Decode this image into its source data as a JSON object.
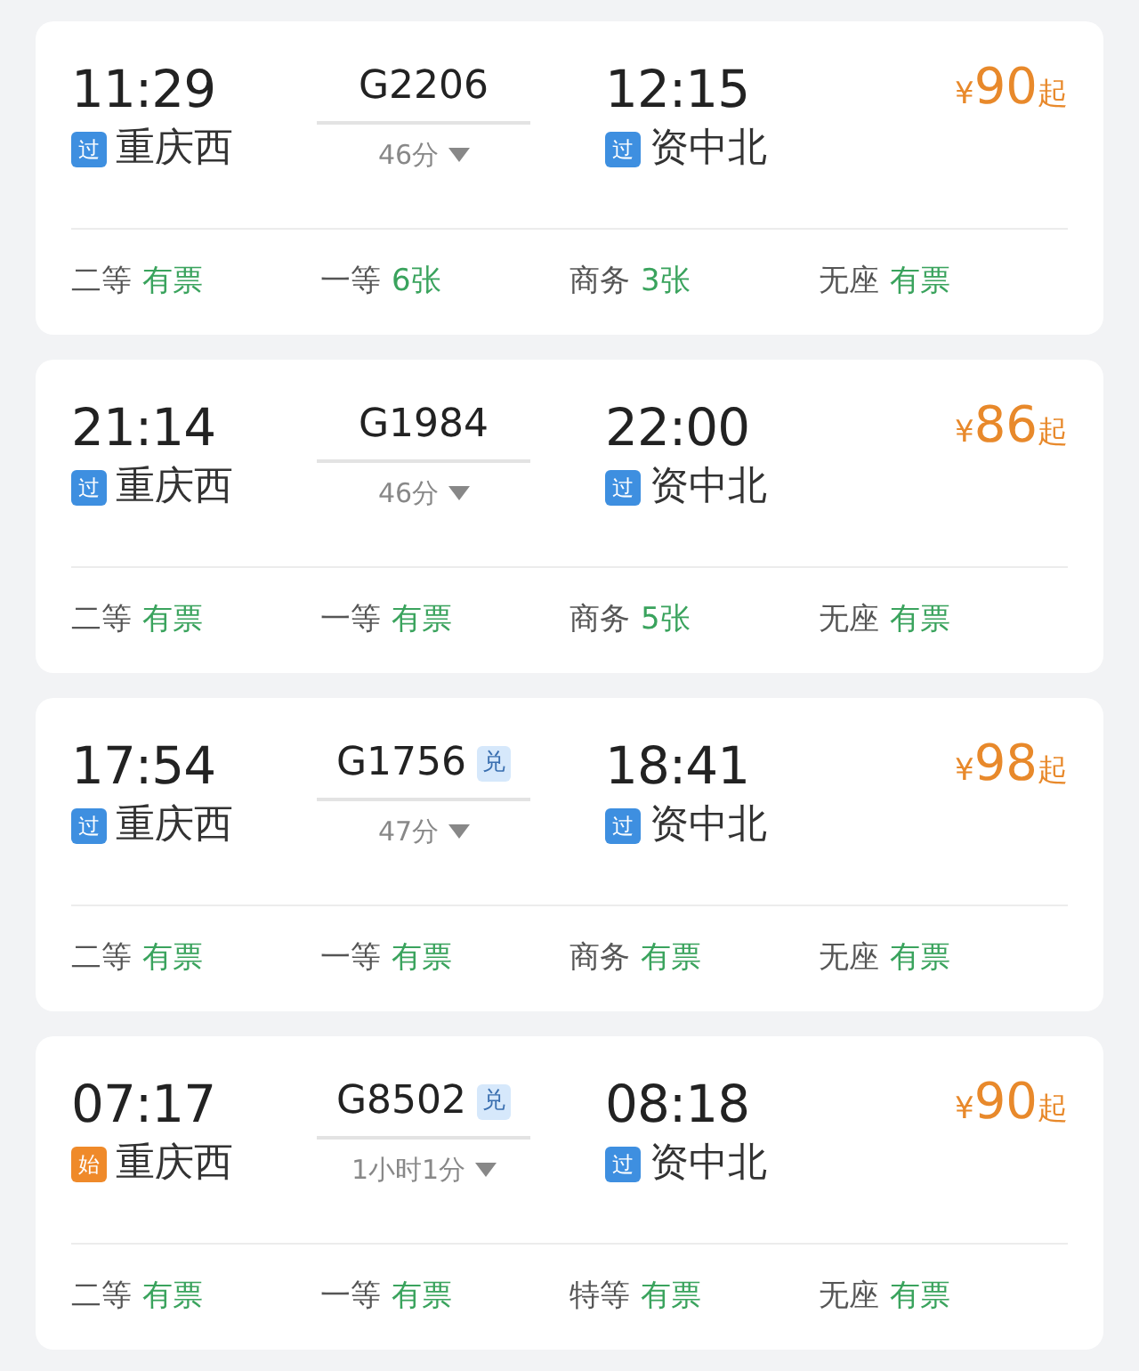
{
  "trains": [
    {
      "depart_time": "11:29",
      "train_no": "G2206",
      "duration": "46分",
      "arrive_time": "12:15",
      "price_symbol": "¥",
      "price": "90",
      "price_suffix": "起",
      "from": {
        "badge": "过",
        "kind": "pass",
        "name": "重庆西"
      },
      "to": {
        "badge": "过",
        "kind": "pass",
        "name": "资中北"
      },
      "seats": [
        {
          "class": "二等",
          "availability": "有票"
        },
        {
          "class": "一等",
          "availability": "6张"
        },
        {
          "class": "商务",
          "availability": "3张"
        },
        {
          "class": "无座",
          "availability": "有票"
        }
      ]
    },
    {
      "depart_time": "21:14",
      "train_no": "G1984",
      "duration": "46分",
      "arrive_time": "22:00",
      "price_symbol": "¥",
      "price": "86",
      "price_suffix": "起",
      "from": {
        "badge": "过",
        "kind": "pass",
        "name": "重庆西"
      },
      "to": {
        "badge": "过",
        "kind": "pass",
        "name": "资中北"
      },
      "seats": [
        {
          "class": "二等",
          "availability": "有票"
        },
        {
          "class": "一等",
          "availability": "有票"
        },
        {
          "class": "商务",
          "availability": "5张"
        },
        {
          "class": "无座",
          "availability": "有票"
        }
      ]
    },
    {
      "depart_time": "17:54",
      "train_no": "G1756",
      "tag": "兑",
      "duration": "47分",
      "arrive_time": "18:41",
      "price_symbol": "¥",
      "price": "98",
      "price_suffix": "起",
      "from": {
        "badge": "过",
        "kind": "pass",
        "name": "重庆西"
      },
      "to": {
        "badge": "过",
        "kind": "pass",
        "name": "资中北"
      },
      "seats": [
        {
          "class": "二等",
          "availability": "有票"
        },
        {
          "class": "一等",
          "availability": "有票"
        },
        {
          "class": "商务",
          "availability": "有票"
        },
        {
          "class": "无座",
          "availability": "有票"
        }
      ]
    },
    {
      "depart_time": "07:17",
      "train_no": "G8502",
      "tag": "兑",
      "duration": "1小时1分",
      "arrive_time": "08:18",
      "price_symbol": "¥",
      "price": "90",
      "price_suffix": "起",
      "from": {
        "badge": "始",
        "kind": "start",
        "name": "重庆西"
      },
      "to": {
        "badge": "过",
        "kind": "pass",
        "name": "资中北"
      },
      "seats": [
        {
          "class": "二等",
          "availability": "有票"
        },
        {
          "class": "一等",
          "availability": "有票"
        },
        {
          "class": "特等",
          "availability": "有票"
        },
        {
          "class": "无座",
          "availability": "有票"
        }
      ]
    }
  ]
}
